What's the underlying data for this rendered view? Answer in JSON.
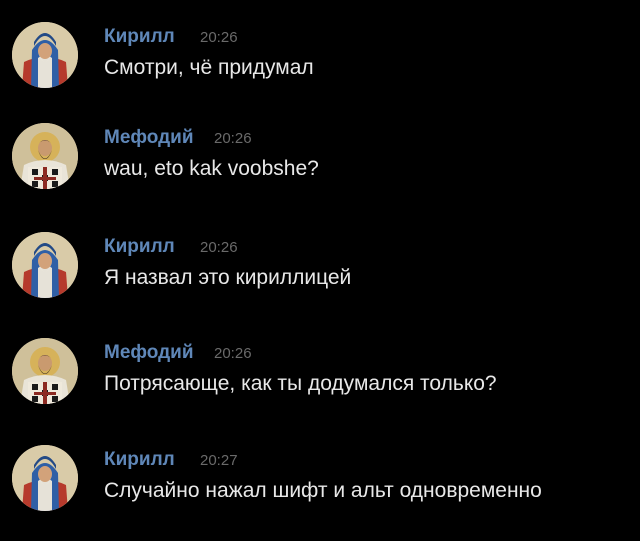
{
  "messages": [
    {
      "author": "Кирилл",
      "time": "20:26",
      "text": "Смотри, чё придумал",
      "avatar": "kirill-icon-avatar"
    },
    {
      "author": "Мефодий",
      "time": "20:26",
      "text": "wau, eto kak voobshe?",
      "avatar": "mefody-icon-avatar"
    },
    {
      "author": "Кирилл",
      "time": "20:26",
      "text": "Я назвал это кириллицей",
      "avatar": "kirill-icon-avatar"
    },
    {
      "author": "Мефодий",
      "time": "20:26",
      "text": "Потрясающе, как ты додумался только?",
      "avatar": "mefody-icon-avatar"
    },
    {
      "author": "Кирилл",
      "time": "20:27",
      "text": "Случайно нажал шифт и альт одновременно",
      "avatar": "kirill-icon-avatar"
    }
  ],
  "colors": {
    "background": "#000000",
    "author_name": "#5f87b8",
    "timestamp": "#6a6a6a",
    "message_text": "#e8e8e8"
  }
}
